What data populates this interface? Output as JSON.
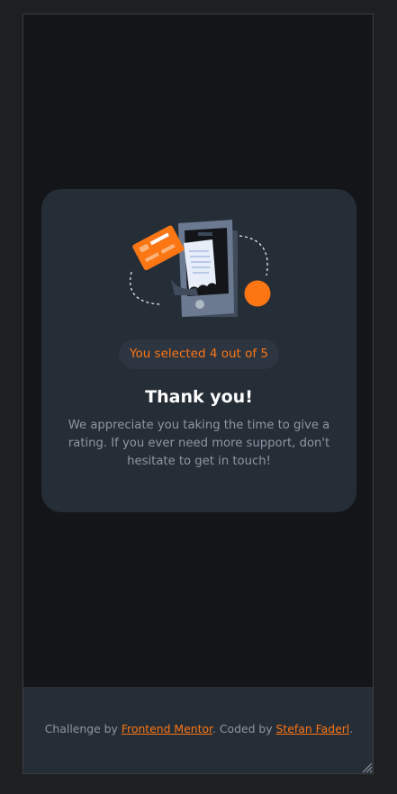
{
  "card": {
    "selection_text": "You selected 4 out of 5",
    "title": "Thank you!",
    "message": "We appreciate you taking the time to give a rating. If you ever need more support, don't hesitate to get in touch!",
    "illustration_icon": "payment-phone-illustration-icon"
  },
  "footer": {
    "prefix": "Challenge by ",
    "link1": "Frontend Mentor",
    "middle": ". Coded by ",
    "link2": "Stefan Faderl",
    "suffix": "."
  },
  "colors": {
    "page_bg": "#131518",
    "card_bg": "#252d37",
    "accent": "#fc7614",
    "muted_text": "#8f96a3"
  }
}
